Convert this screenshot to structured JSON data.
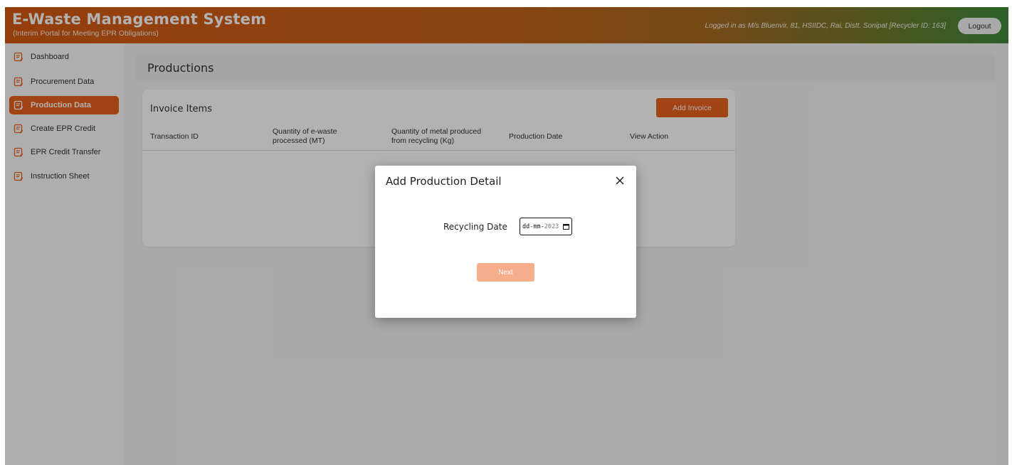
{
  "header": {
    "title": "E-Waste Management System",
    "subtitle": "(Interim Portal for Meeting EPR Obligations)",
    "logged_in_text": "Logged in as M/s Bluenvir, 81, HSIIDC, Rai, Distt. Sonipat [Recycler ID: 163]",
    "logout_label": "Logout"
  },
  "sidebar": {
    "items": [
      {
        "label": "Dashboard",
        "active": false,
        "icon": "document-edit-icon"
      },
      {
        "label": "Procurement Data",
        "active": false,
        "icon": "document-edit-icon"
      },
      {
        "label": "Production Data",
        "active": true,
        "icon": "document-edit-icon"
      },
      {
        "label": "Create EPR Credit",
        "active": false,
        "icon": "document-edit-icon"
      },
      {
        "label": "EPR Credit Transfer",
        "active": false,
        "icon": "document-edit-icon"
      },
      {
        "label": "Instruction Sheet",
        "active": false,
        "icon": "document-edit-icon"
      }
    ]
  },
  "page": {
    "title": "Productions"
  },
  "invoice_card": {
    "title": "Invoice Items",
    "add_button": "Add Invoice",
    "columns": [
      {
        "line1": "Transaction ID",
        "line2": ""
      },
      {
        "line1": "Quantity of e-waste",
        "line2": "processed (MT)"
      },
      {
        "line1": "Quantity of metal produced",
        "line2": "from recycling (Kg)"
      },
      {
        "line1": "Production Date",
        "line2": ""
      },
      {
        "line1": "View Action",
        "line2": ""
      }
    ]
  },
  "modal": {
    "title": "Add Production Detail",
    "date_label": "Recycling Date",
    "date_placeholder": "dd-mm-",
    "date_year": "2023",
    "next_label": "Next"
  },
  "colors": {
    "accent": "#e8601c",
    "next_disabled": "#f6ad8c"
  }
}
